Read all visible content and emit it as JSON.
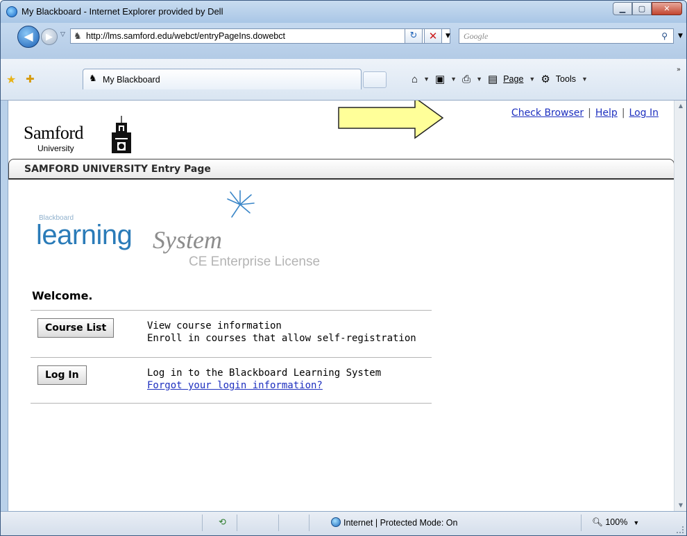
{
  "window": {
    "title": "My Blackboard - Internet Explorer provided by Dell"
  },
  "address_bar": {
    "url": "http://lms.samford.edu/webct/entryPageIns.dowebct"
  },
  "search": {
    "placeholder": "Google"
  },
  "tab": {
    "label": "My Blackboard"
  },
  "command_bar": {
    "page_label": "Page",
    "tools_label": "Tools"
  },
  "header": {
    "logo_name": "Samford",
    "logo_sub": "University",
    "links": {
      "check_browser": "Check Browser",
      "separator": "|",
      "help": "Help",
      "log_in": "Log In"
    }
  },
  "entry_bar": {
    "title": "SAMFORD UNIVERSITY Entry Page"
  },
  "product_logo": {
    "small": "Blackboard",
    "learning": "learning",
    "system": "System",
    "license": "CE Enterprise License"
  },
  "main": {
    "welcome": "Welcome.",
    "rows": [
      {
        "button": "Course List",
        "line1": "View course information",
        "line2": "Enroll in courses that allow self-registration"
      },
      {
        "button": "Log In",
        "line1": "Log in to the Blackboard Learning System",
        "link": "Forgot your login information?"
      }
    ]
  },
  "status_bar": {
    "zone": "Internet | Protected Mode: On",
    "zoom": "100%"
  },
  "colors": {
    "link": "#1d2fbf",
    "arrow_fill": "#ffff99",
    "blackboard_blue": "#2a7bb8"
  }
}
